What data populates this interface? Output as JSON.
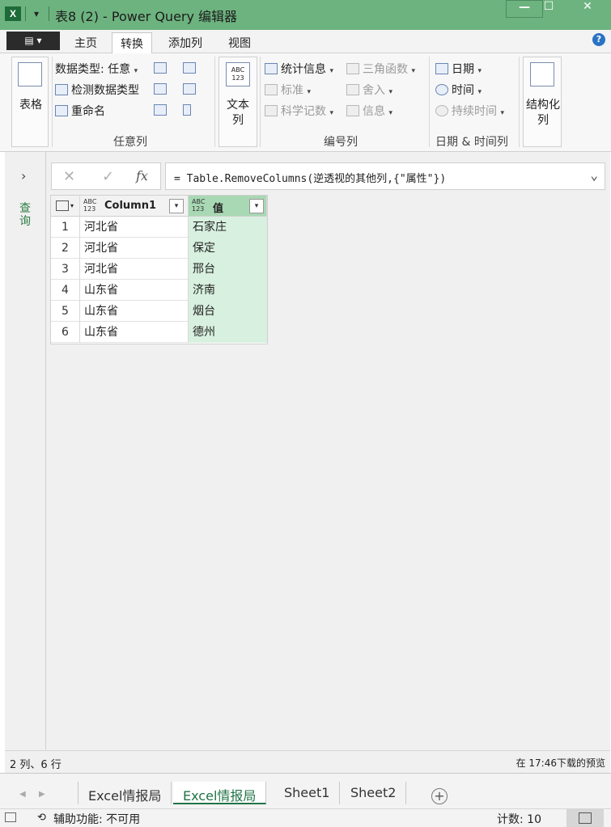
{
  "window": {
    "title": "表8 (2) - Power Query 编辑器",
    "logo_text": "X",
    "min_label": "—",
    "max_label": "☐",
    "close_label": "✕",
    "qat_label": "▾"
  },
  "ribbon_tabs": {
    "file_label": "▤ ▾",
    "tabs": [
      "主页",
      "转换",
      "添加列",
      "视图"
    ],
    "active": "转换",
    "help": "?"
  },
  "ribbon": {
    "table_btn": "表格",
    "any_column": {
      "data_type": "数据类型: 任意",
      "detect_type": "检测数据类型",
      "rename": "重命名",
      "label": "任意列"
    },
    "text_column_btn": "文本列",
    "number_column": {
      "statistics": "统计信息",
      "standard": "标准",
      "scientific": "科学记数",
      "trig": "三角函数",
      "rounding": "舍入",
      "information": "信息",
      "label": "编号列"
    },
    "datetime_column": {
      "date": "日期",
      "time": "时间",
      "duration": "持续时间",
      "label": "日期 & 时间列"
    },
    "structured_btn": "结构化列"
  },
  "queries_pane": {
    "label": "查询",
    "expand": "›"
  },
  "formula_bar": {
    "cancel": "✕",
    "confirm": "✓",
    "fx": "fx",
    "formula": "= Table.RemoveColumns(逆透视的其他列,{\"属性\"})",
    "expand": "⌄"
  },
  "grid": {
    "columns": [
      {
        "name": "Column1",
        "type": "ABC\n123"
      },
      {
        "name": "值",
        "type": "ABC\n123"
      }
    ],
    "rows": [
      {
        "n": "1",
        "c1": "河北省",
        "c2": "石家庄"
      },
      {
        "n": "2",
        "c1": "河北省",
        "c2": "保定"
      },
      {
        "n": "3",
        "c1": "河北省",
        "c2": "邢台"
      },
      {
        "n": "4",
        "c1": "山东省",
        "c2": "济南"
      },
      {
        "n": "5",
        "c1": "山东省",
        "c2": "烟台"
      },
      {
        "n": "6",
        "c1": "山东省",
        "c2": "德州"
      }
    ]
  },
  "status": {
    "left": "2 列、6 行",
    "right": "在 17:46下载的预览"
  },
  "sheets": {
    "tabs": [
      "Excel情报局",
      "Excel情报局",
      "Sheet1",
      "Sheet2"
    ],
    "active_index": 1,
    "add": "+"
  },
  "excel_status": {
    "accessibility": "辅助功能: 不可用",
    "count": "计数: 10"
  },
  "colors": {
    "titlebar": "#6db37f",
    "accent": "#217346",
    "value_column": "#d8f0df"
  }
}
